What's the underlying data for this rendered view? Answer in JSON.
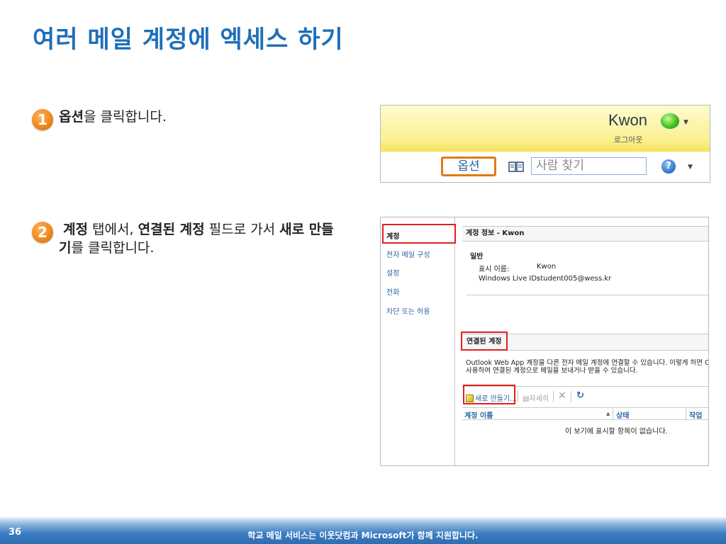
{
  "title": "여러 메일 계정에 엑세스 하기",
  "steps": [
    {
      "number": "1",
      "bold": "옵션",
      "text": "을 클릭합니다."
    },
    {
      "number": "2",
      "bold1": "계정",
      "text1": " 탭에서, ",
      "bold2": "연결된 계정",
      "text2": " 필드로 가서 ",
      "bold3": "새로 만들기",
      "text3": "를 클릭합니다."
    }
  ],
  "header_shot": {
    "user_name": "Kwon",
    "logout": "로그아웃",
    "options": "옵션",
    "search_placeholder": "사람 찾기",
    "help": "?",
    "presence_color": "#45c020"
  },
  "account_shot": {
    "nav": [
      "계정",
      "전자 메일 구성",
      "설정",
      "전화",
      "차단 또는 허용"
    ],
    "panel_title": "계정 정보 - Kwon",
    "general_label": "일반",
    "display_name_label": "표시 이름:",
    "display_name_value": "Kwon",
    "live_id_label": "Windows Live ID:",
    "live_id_value": "student005@wess.kr",
    "linked_title": "연결된 계정",
    "description_line1": "Outlook Web App 계정을 다른 전자 메일 계정에 연결할 수 있습니다. 이렇게 하면 Outlool",
    "description_line2": "사용하여 연결된 계정으로 메일을 보내거나 받을 수 있습니다.",
    "new_button": "새로 만들기...",
    "details_button": "자세히",
    "col_account_name": "계정 이름",
    "col_status": "상태",
    "col_action": "작업",
    "sort_indicator": "▲",
    "empty_message": "이 보기에 표시할 항목이 없습니다."
  },
  "footer": {
    "page_number": "36",
    "text": "학교 메일 서비스는 이웃닷컴과 Microsoft가 함께 지원합니다."
  },
  "colors": {
    "title": "#1e6fb8",
    "highlight_orange": "#e07b17",
    "highlight_red": "#e02020",
    "footer_blue": "#2d6db0"
  }
}
